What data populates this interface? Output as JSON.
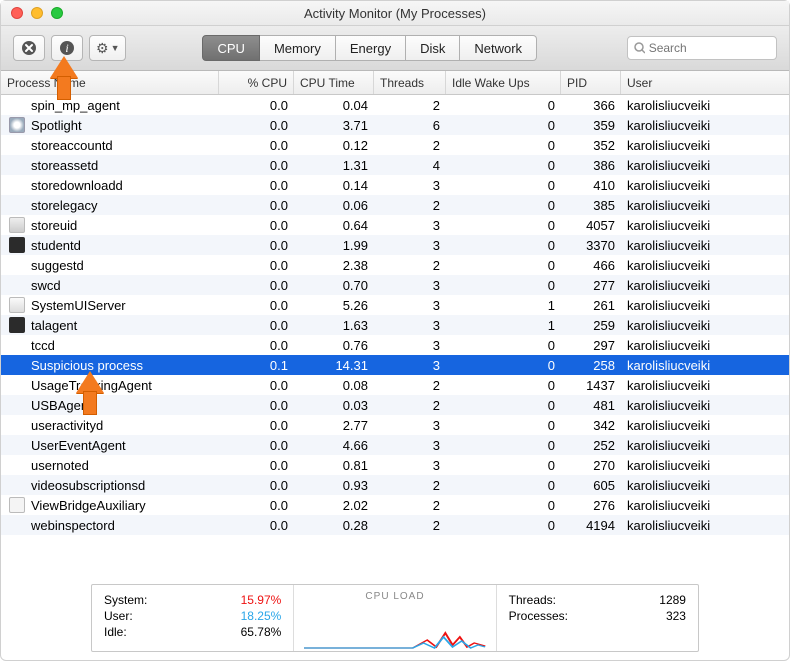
{
  "window": {
    "title": "Activity Monitor (My Processes)"
  },
  "toolbar": {
    "tabs": [
      "CPU",
      "Memory",
      "Energy",
      "Disk",
      "Network"
    ],
    "active_tab": 0,
    "search_placeholder": "Search"
  },
  "columns": {
    "name": "Process Name",
    "cpu": "% CPU",
    "time": "CPU Time",
    "threads": "Threads",
    "wake": "Idle Wake Ups",
    "pid": "PID",
    "user": "User"
  },
  "rows": [
    {
      "icon": "",
      "name": "spin_mp_agent",
      "cpu": "0.0",
      "time": "0.04",
      "th": "2",
      "wk": "0",
      "pid": "366",
      "user": "karolisliucveiki",
      "sel": false
    },
    {
      "icon": "spotlight",
      "name": "Spotlight",
      "cpu": "0.0",
      "time": "3.71",
      "th": "6",
      "wk": "0",
      "pid": "359",
      "user": "karolisliucveiki",
      "sel": false
    },
    {
      "icon": "",
      "name": "storeaccountd",
      "cpu": "0.0",
      "time": "0.12",
      "th": "2",
      "wk": "0",
      "pid": "352",
      "user": "karolisliucveiki",
      "sel": false
    },
    {
      "icon": "",
      "name": "storeassetd",
      "cpu": "0.0",
      "time": "1.31",
      "th": "4",
      "wk": "0",
      "pid": "386",
      "user": "karolisliucveiki",
      "sel": false
    },
    {
      "icon": "",
      "name": "storedownloadd",
      "cpu": "0.0",
      "time": "0.14",
      "th": "3",
      "wk": "0",
      "pid": "410",
      "user": "karolisliucveiki",
      "sel": false
    },
    {
      "icon": "",
      "name": "storelegacy",
      "cpu": "0.0",
      "time": "0.06",
      "th": "2",
      "wk": "0",
      "pid": "385",
      "user": "karolisliucveiki",
      "sel": false
    },
    {
      "icon": "generic",
      "name": "storeuid",
      "cpu": "0.0",
      "time": "0.64",
      "th": "3",
      "wk": "0",
      "pid": "4057",
      "user": "karolisliucveiki",
      "sel": false
    },
    {
      "icon": "dark",
      "name": "studentd",
      "cpu": "0.0",
      "time": "1.99",
      "th": "3",
      "wk": "0",
      "pid": "3370",
      "user": "karolisliucveiki",
      "sel": false
    },
    {
      "icon": "",
      "name": "suggestd",
      "cpu": "0.0",
      "time": "2.38",
      "th": "2",
      "wk": "0",
      "pid": "466",
      "user": "karolisliucveiki",
      "sel": false
    },
    {
      "icon": "",
      "name": "swcd",
      "cpu": "0.0",
      "time": "0.70",
      "th": "3",
      "wk": "0",
      "pid": "277",
      "user": "karolisliucveiki",
      "sel": false
    },
    {
      "icon": "sysu",
      "name": "SystemUIServer",
      "cpu": "0.0",
      "time": "5.26",
      "th": "3",
      "wk": "1",
      "pid": "261",
      "user": "karolisliucveiki",
      "sel": false
    },
    {
      "icon": "dark",
      "name": "talagent",
      "cpu": "0.0",
      "time": "1.63",
      "th": "3",
      "wk": "1",
      "pid": "259",
      "user": "karolisliucveiki",
      "sel": false
    },
    {
      "icon": "",
      "name": "tccd",
      "cpu": "0.0",
      "time": "0.76",
      "th": "3",
      "wk": "0",
      "pid": "297",
      "user": "karolisliucveiki",
      "sel": false
    },
    {
      "icon": "",
      "name": "Suspicious process",
      "cpu": "0.1",
      "time": "14.31",
      "th": "3",
      "wk": "0",
      "pid": "258",
      "user": "karolisliucveiki",
      "sel": true
    },
    {
      "icon": "",
      "name": "UsageTrackingAgent",
      "cpu": "0.0",
      "time": "0.08",
      "th": "2",
      "wk": "0",
      "pid": "1437",
      "user": "karolisliucveiki",
      "sel": false
    },
    {
      "icon": "",
      "name": "USBAgent",
      "cpu": "0.0",
      "time": "0.03",
      "th": "2",
      "wk": "0",
      "pid": "481",
      "user": "karolisliucveiki",
      "sel": false
    },
    {
      "icon": "",
      "name": "useractivityd",
      "cpu": "0.0",
      "time": "2.77",
      "th": "3",
      "wk": "0",
      "pid": "342",
      "user": "karolisliucveiki",
      "sel": false
    },
    {
      "icon": "",
      "name": "UserEventAgent",
      "cpu": "0.0",
      "time": "4.66",
      "th": "3",
      "wk": "0",
      "pid": "252",
      "user": "karolisliucveiki",
      "sel": false
    },
    {
      "icon": "",
      "name": "usernoted",
      "cpu": "0.0",
      "time": "0.81",
      "th": "3",
      "wk": "0",
      "pid": "270",
      "user": "karolisliucveiki",
      "sel": false
    },
    {
      "icon": "",
      "name": "videosubscriptionsd",
      "cpu": "0.0",
      "time": "0.93",
      "th": "2",
      "wk": "0",
      "pid": "605",
      "user": "karolisliucveiki",
      "sel": false
    },
    {
      "icon": "tag",
      "name": "ViewBridgeAuxiliary",
      "cpu": "0.0",
      "time": "2.02",
      "th": "2",
      "wk": "0",
      "pid": "276",
      "user": "karolisliucveiki",
      "sel": false
    },
    {
      "icon": "",
      "name": "webinspectord",
      "cpu": "0.0",
      "time": "0.28",
      "th": "2",
      "wk": "0",
      "pid": "4194",
      "user": "karolisliucveiki",
      "sel": false
    }
  ],
  "footer": {
    "system_label": "System:",
    "system_val": "15.97%",
    "system_color": "#e11",
    "user_label": "User:",
    "user_val": "18.25%",
    "user_color": "#2aa6e8",
    "idle_label": "Idle:",
    "idle_val": "65.78%",
    "cpuload": "CPU LOAD",
    "threads_label": "Threads:",
    "threads_val": "1289",
    "procs_label": "Processes:",
    "procs_val": "323"
  },
  "icons": {
    "stop": "✕",
    "info": "i",
    "gear": "⚙︎",
    "search": "🔍"
  }
}
